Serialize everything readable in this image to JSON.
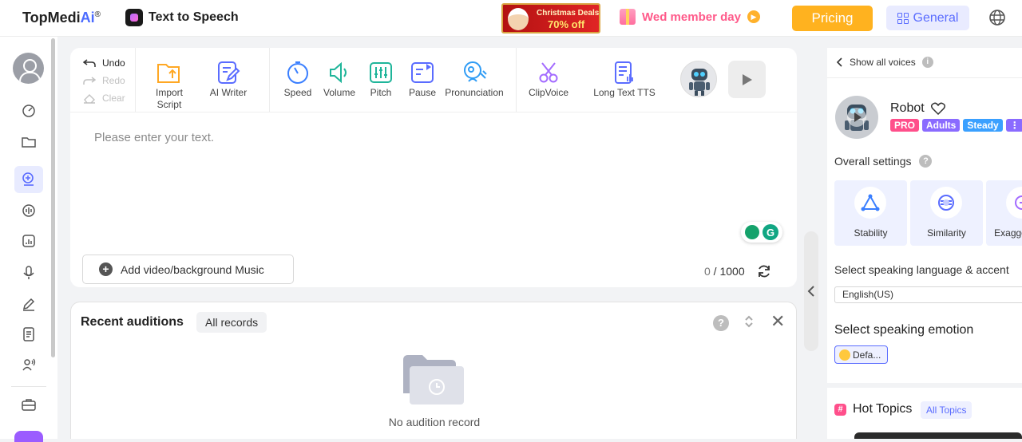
{
  "header": {
    "brand_main": "TopMedi",
    "brand_ai": "Ai",
    "brand_reg": "®",
    "app_title": "Text to Speech",
    "promo_line1": "Christmas Deals",
    "promo_line2": "70% off",
    "member_day": "Wed member day",
    "pricing": "Pricing",
    "general": "General"
  },
  "sidebar": {
    "icons": [
      "gauge-icon",
      "folder-icon",
      "text-to-speech-icon",
      "voice-wave-icon",
      "audio-chart-icon",
      "microphone-icon",
      "pen-icon",
      "document-icon",
      "speaker-person-icon",
      "toolbox-icon"
    ]
  },
  "history": {
    "undo": "Undo",
    "redo": "Redo",
    "clear": "Clear"
  },
  "toolbar": {
    "import_script": "Import\nScript",
    "ai_writer": "AI Writer",
    "speed": "Speed",
    "volume": "Volume",
    "pitch": "Pitch",
    "pause": "Pause",
    "pronunciation": "Pronunciation",
    "clipvoice": "ClipVoice",
    "long_text": "Long Text TTS"
  },
  "editor": {
    "placeholder": "Please enter your text.",
    "music_button": "Add video/background Music",
    "count_current": "0",
    "count_sep": " / ",
    "count_max": "1000"
  },
  "recent": {
    "title": "Recent auditions",
    "all_records": "All records",
    "help": "?",
    "empty": "No audition record"
  },
  "voice_panel": {
    "show_all": "Show all voices",
    "voice_name": "Robot",
    "tags": [
      {
        "label": "PRO",
        "color": "#ff4f8b"
      },
      {
        "label": "Adults",
        "color": "#8a6bff"
      },
      {
        "label": "Steady",
        "color": "#3aa0ff"
      },
      {
        "label": "⋮",
        "color": "#8a6bff"
      }
    ],
    "overall_settings": "Overall settings",
    "settings": [
      "Stability",
      "Similarity",
      "Exaggeration"
    ],
    "language_label": "Select speaking language & accent",
    "language_value": "English(US)",
    "emotion_label": "Select speaking emotion",
    "emotion_value": "Defa...",
    "hot_topics": "Hot Topics",
    "all_topics": "All Topics"
  },
  "colors": {
    "accent": "#5a6cff",
    "pricing": "#ffb21f",
    "pink": "#ff4f8b"
  }
}
